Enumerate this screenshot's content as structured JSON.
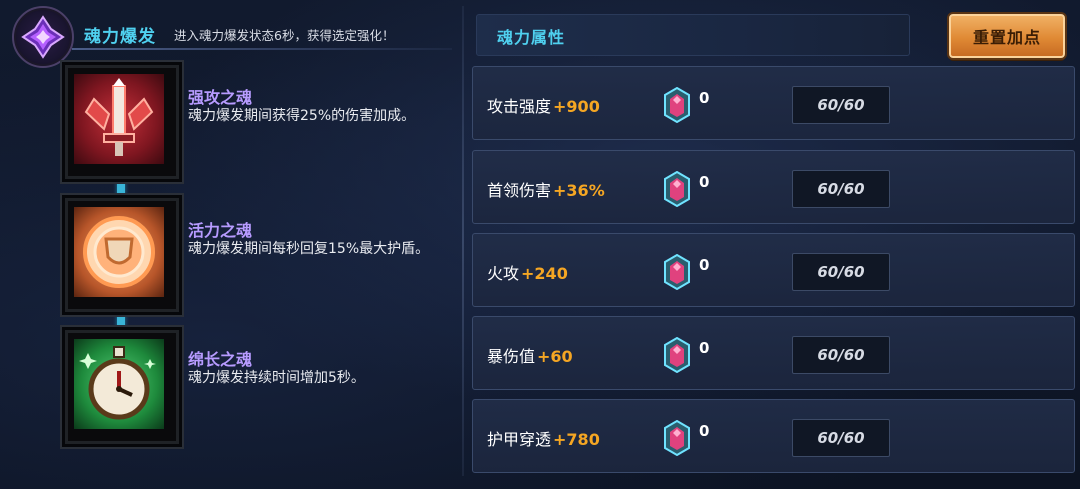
{
  "burst": {
    "title": "魂力爆发",
    "description": "进入魂力爆发状态6秒，获得选定强化！"
  },
  "souls": [
    {
      "name": "强攻之魂",
      "description": "魂力爆发期间获得25%的伤害加成。",
      "icon": "red-sword-icon",
      "color": "#b3212c"
    },
    {
      "name": "活力之魂",
      "description": "魂力爆发期间每秒回复15%最大护盾。",
      "icon": "shield-emblem-icon",
      "color": "#e38a4b"
    },
    {
      "name": "绵长之魂",
      "description": "魂力爆发持续时间增加5秒。",
      "icon": "stopwatch-icon",
      "color": "#2fa84a"
    }
  ],
  "attributes": {
    "title": "魂力属性",
    "reset_label": "重置加点",
    "rows": [
      {
        "label": "攻击强度",
        "bonus": "+900",
        "gem_count": "0",
        "level": "60/60"
      },
      {
        "label": "首领伤害",
        "bonus": "+36%",
        "gem_count": "0",
        "level": "60/60"
      },
      {
        "label": "火攻",
        "bonus": "+240",
        "gem_count": "0",
        "level": "60/60"
      },
      {
        "label": "暴伤值",
        "bonus": "+60",
        "gem_count": "0",
        "level": "60/60"
      },
      {
        "label": "护甲穿透",
        "bonus": "+780",
        "gem_count": "0",
        "level": "60/60"
      }
    ]
  },
  "colors": {
    "accent_cyan": "#4fd0ef",
    "soul_name": "#b79bff",
    "bonus_orange": "#f5a623",
    "button_orange": "#e08a35"
  }
}
